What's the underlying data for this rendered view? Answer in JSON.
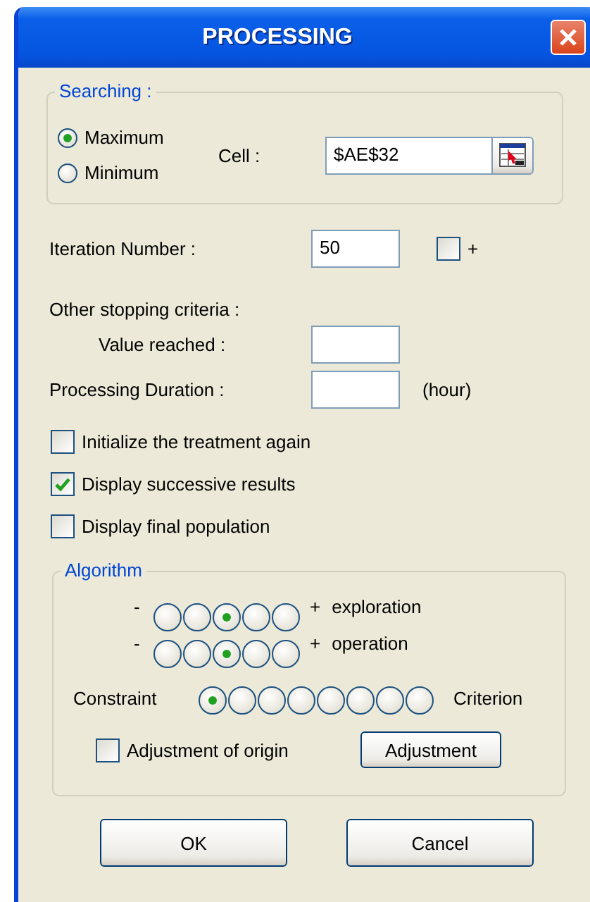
{
  "window": {
    "title": "PROCESSING"
  },
  "searching": {
    "legend": "Searching :",
    "options": [
      {
        "label": "Maximum",
        "selected": true
      },
      {
        "label": "Minimum",
        "selected": false
      }
    ],
    "cell_label": "Cell :",
    "cell_value": "$AE$32"
  },
  "iteration": {
    "label": "Iteration Number :",
    "value": "50",
    "plus_label": "+",
    "plus_checked": false
  },
  "stopping": {
    "label": "Other stopping criteria :",
    "value_reached_label": "Value reached :",
    "duration_label": "Processing Duration :",
    "duration_unit": "(hour)"
  },
  "checks": [
    {
      "label": "Initialize the treatment again",
      "checked": false
    },
    {
      "label": "Display successive results",
      "checked": true
    },
    {
      "label": "Display final population",
      "checked": false
    }
  ],
  "algorithm": {
    "legend": "Algorithm",
    "scales": [
      {
        "minus": "-",
        "plus": "+",
        "name": "exploration",
        "options": [
          {
            "selected": false
          },
          {
            "selected": false
          },
          {
            "selected": true
          },
          {
            "selected": false
          },
          {
            "selected": false
          }
        ]
      },
      {
        "minus": "-",
        "plus": "+",
        "name": "operation",
        "options": [
          {
            "selected": false
          },
          {
            "selected": false
          },
          {
            "selected": true
          },
          {
            "selected": false
          },
          {
            "selected": false
          }
        ]
      }
    ],
    "balance": {
      "left": "Constraint",
      "right": "Criterion",
      "options": [
        {
          "selected": true
        },
        {
          "selected": false
        },
        {
          "selected": false
        },
        {
          "selected": false
        },
        {
          "selected": false
        },
        {
          "selected": false
        },
        {
          "selected": false
        },
        {
          "selected": false
        }
      ]
    },
    "origin": {
      "label": "Adjustment of origin",
      "checked": false
    },
    "adjust_button": "Adjustment"
  },
  "buttons": [
    "OK",
    "Cancel"
  ]
}
